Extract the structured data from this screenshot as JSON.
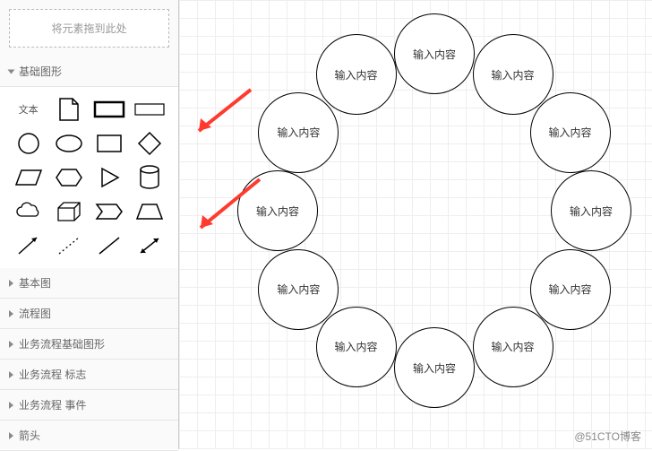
{
  "sidebar": {
    "dropzone": "将元素拖到此处",
    "sections": [
      {
        "label": "基础图形",
        "open": true
      },
      {
        "label": "基本图",
        "open": false
      },
      {
        "label": "流程图",
        "open": false
      },
      {
        "label": "业务流程基础图形",
        "open": false
      },
      {
        "label": "业务流程 标志",
        "open": false
      },
      {
        "label": "业务流程 事件",
        "open": false
      },
      {
        "label": "箭头",
        "open": false
      }
    ],
    "shapes": {
      "text_label": "文本",
      "items": [
        "text",
        "page",
        "rect-thick",
        "rect-thin",
        "circle",
        "ellipse",
        "square",
        "diamond",
        "parallelogram",
        "hexagon",
        "triangle",
        "cylinder",
        "cloud",
        "cube",
        "step",
        "trapezoid",
        "arrow-ne",
        "dotted",
        "line",
        "double-arrow"
      ]
    }
  },
  "canvas": {
    "node_placeholder": "输入内容",
    "node_count": 12
  },
  "annotation": {
    "arrow_color": "#ff3b30"
  },
  "watermark": "@51CTO博客"
}
